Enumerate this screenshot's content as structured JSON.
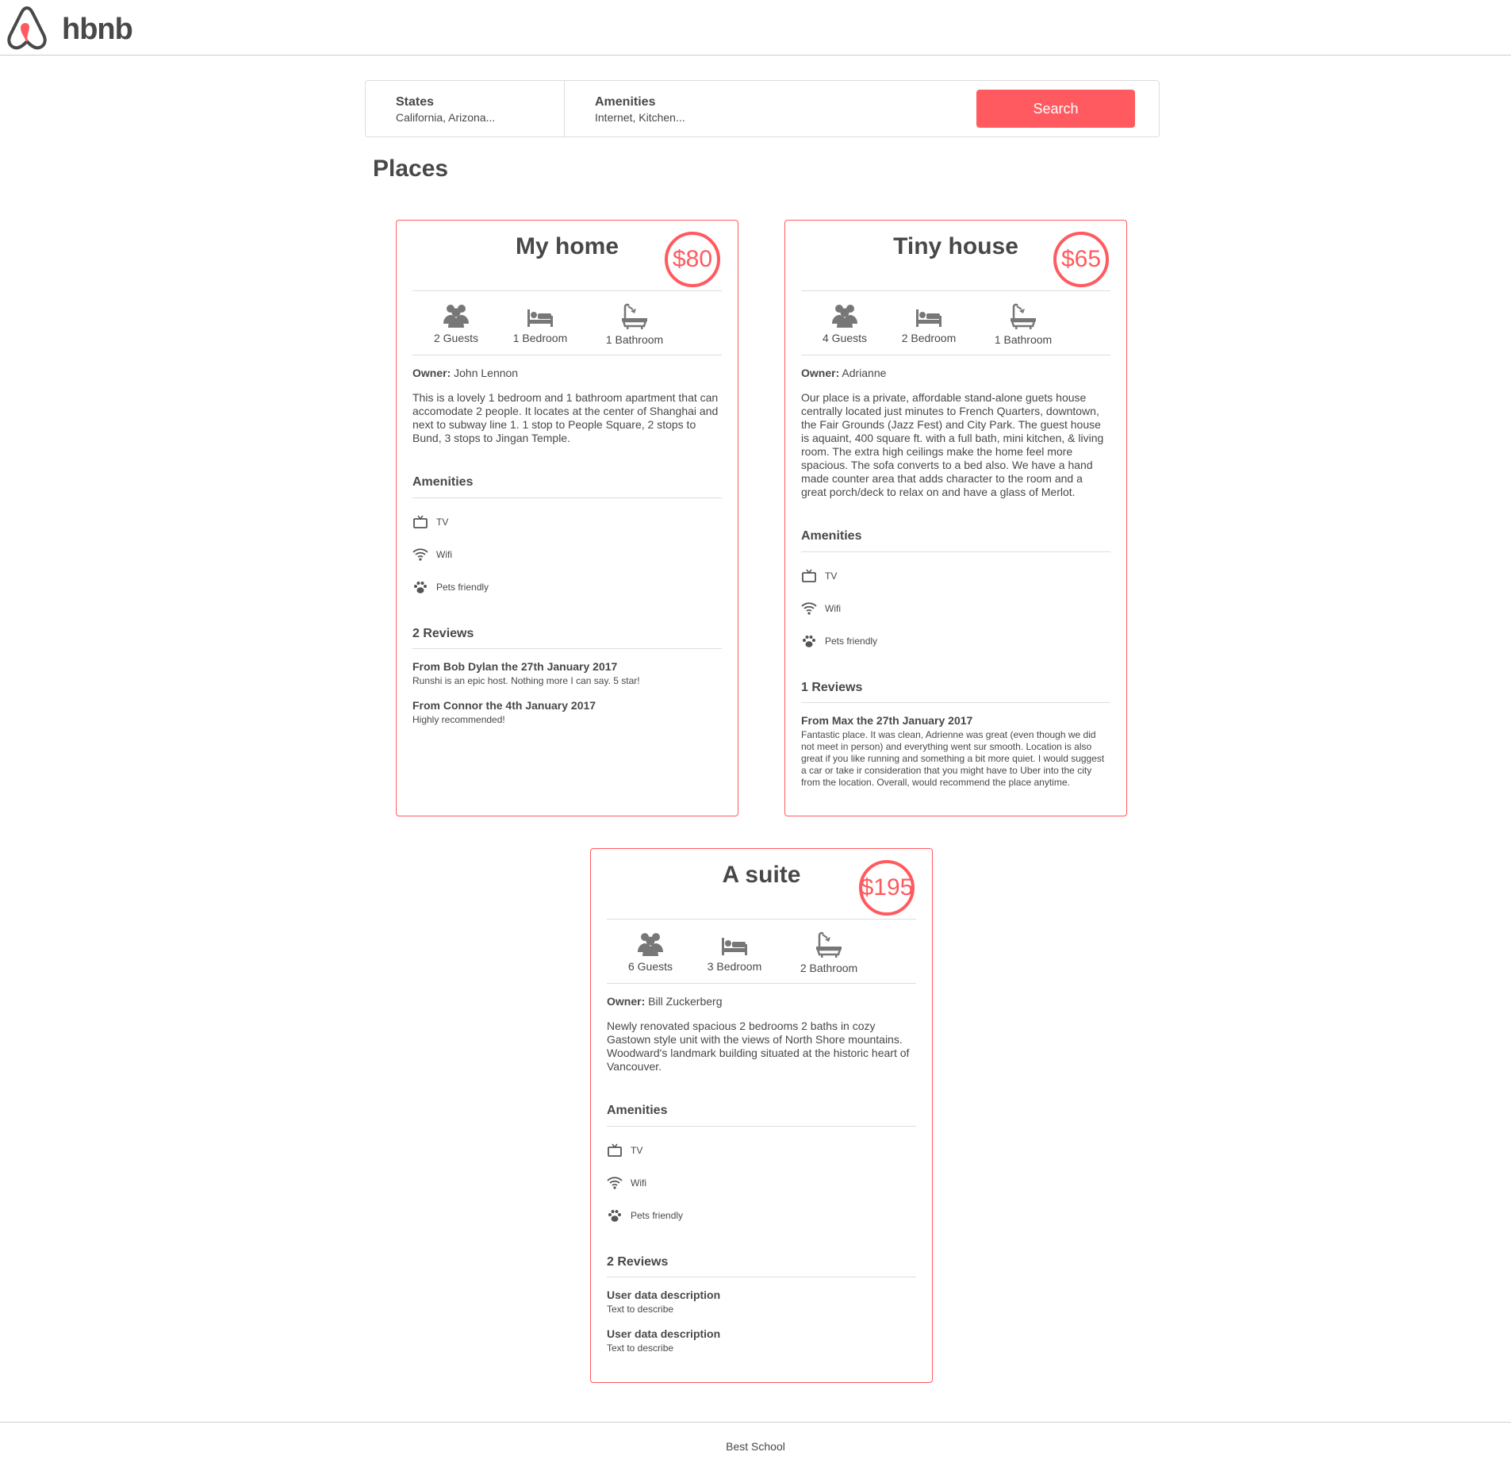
{
  "header": {
    "logo_text": "hbnb"
  },
  "filters": {
    "states_title": "States",
    "states_value": "California, Arizona...",
    "amenities_title": "Amenities",
    "amenities_value": "Internet, Kitchen...",
    "search_label": "Search"
  },
  "places_title": "Places",
  "places": [
    {
      "name": "My home",
      "price": "$80",
      "guests": "2 Guests",
      "bedrooms": "1 Bedroom",
      "bathrooms": "1 Bathroom",
      "owner_label": "Owner:",
      "owner": "John Lennon",
      "description": "This is a lovely 1 bedroom and 1 bathroom apartment that can accomodate 2 people. It locates at the center of Shanghai and next to subway line 1. 1 stop to People Square, 2 stops to Bund, 3 stops to Jingan Temple.",
      "amenities_title": "Amenities",
      "amenities": [
        "TV",
        "Wifi",
        "Pets friendly"
      ],
      "reviews_title": "2 Reviews",
      "reviews": [
        {
          "title": "From Bob Dylan the 27th January 2017",
          "text": "Runshi is an epic host. Nothing more I can say. 5 star!"
        },
        {
          "title": "From Connor the 4th January 2017",
          "text": "Highly recommended!"
        }
      ]
    },
    {
      "name": "Tiny house",
      "price": "$65",
      "guests": "4 Guests",
      "bedrooms": "2 Bedroom",
      "bathrooms": "1 Bathroom",
      "owner_label": "Owner:",
      "owner": "Adrianne",
      "description": "Our place is a private, affordable stand-alone guets house centrally located just minutes to French Quarters, downtown, the Fair Grounds (Jazz Fest) and City Park. The guest house is aquaint, 400 square ft. with a full bath, mini kitchen, & living room. The extra high ceilings make the home feel more spacious. The sofa converts to a bed also. We have a hand made counter area that adds character to the room and a great porch/deck to relax on and have a glass of Merlot.",
      "amenities_title": "Amenities",
      "amenities": [
        "TV",
        "Wifi",
        "Pets friendly"
      ],
      "reviews_title": "1 Reviews",
      "reviews": [
        {
          "title": "From Max the 27th January 2017",
          "text": "Fantastic place. It was clean, Adrienne was great (even though we did not meet in person) and everything went sur smooth. Location is also great if you like running and something a bit more quiet. I would suggest a car or take ir consideration that you might have to Uber into the city from the location. Overall, would recommend the place anytime."
        }
      ]
    },
    {
      "name": "A suite",
      "price": "$195",
      "guests": "6 Guests",
      "bedrooms": "3 Bedroom",
      "bathrooms": "2 Bathroom",
      "owner_label": "Owner:",
      "owner": "Bill Zuckerberg",
      "description": "Newly renovated spacious 2 bedrooms 2 baths in cozy Gastown style unit with the views of North Shore mountains. Woodward's landmark building situated at the historic heart of Vancouver.",
      "amenities_title": "Amenities",
      "amenities": [
        "TV",
        "Wifi",
        "Pets friendly"
      ],
      "reviews_title": "2 Reviews",
      "reviews": [
        {
          "title": "User data description",
          "text": "Text to describe"
        },
        {
          "title": "User data description",
          "text": "Text to describe"
        }
      ]
    }
  ],
  "footer": {
    "text": "Best School"
  },
  "colors": {
    "accent": "#ff5a5f",
    "text": "#484848",
    "divider": "#dddddd",
    "icon": "#777777"
  },
  "icons": [
    "airbnb-logo-icon",
    "guests-icon",
    "bed-icon",
    "bathtub-icon",
    "tv-icon",
    "wifi-icon",
    "paw-icon"
  ]
}
